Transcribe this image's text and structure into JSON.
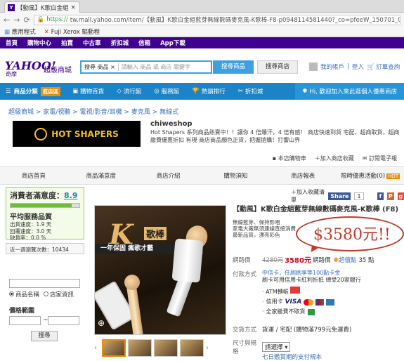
{
  "browser": {
    "tab_title": "【動風】K歌白金組",
    "url_prefix": "https://",
    "url": "tw.mall.yahoo.com/item/【動風】K歌白金組藍芽無線數碼麥克風-K歌棒-F8-p0948114581440?_co=pfeeW_150701_01",
    "bookmarks": [
      "應用程式",
      "Fuji Xerox 驅動程"
    ]
  },
  "ynav": [
    "首頁",
    "購物中心",
    "拍賣",
    "中古車",
    "折扣城",
    "信箱",
    "App下載"
  ],
  "header": {
    "logo": "YAHOO!",
    "logo_sub": "奇摩",
    "mall_name": "超級商城",
    "search_scope": "搜尋 商品 ×",
    "search_placeholder": "請輸入 商品 或 商店 關鍵字",
    "search_goods": "搜尋商品",
    "search_store": "搜尋商店",
    "account": "我的帳戶",
    "login": "登入",
    "orders": "訂單查詢"
  },
  "catbar": {
    "menu": "商品分類",
    "tag": "逛店區",
    "links": [
      "購物百貨",
      "流行館",
      "服務館",
      "熱銷排行",
      "折扣城"
    ],
    "notice": "Hi, 歡迎加入來此逛個人優惠商店"
  },
  "breadcrumb": "超級商城 > 家電/視聽 > 電視/影音/耳機 > 麥克風 > 無線式",
  "shop": {
    "banner": "HOT SHAPERS",
    "name": "chiweshop",
    "desc": "Hot Shapers 系列商品熱賣中！！讓你 4 倍爆汗，4 倍有感！ 商店快速到貨 宅配，超商取貨，超商繳費優惠折扣 有現 商店商品顏色正貨，把握搶購！打響山界",
    "tools": [
      "本店購物車",
      "加入商店收藏",
      "訂閱電子報"
    ],
    "nav": [
      "商店首頁",
      "商品滿意度",
      "商店介紹",
      "購物須知",
      "商店報表",
      "限時優惠活動(0)"
    ],
    "hot_tag": "HOT"
  },
  "rating": {
    "label": "消費者滿意度：",
    "score": "8.9",
    "score_fill": 0.89,
    "avg": "平均服務品質",
    "stats": [
      "出貨速度：1.9 天",
      "回覆速度：3.0 天",
      "缺貨率：0.0 %"
    ],
    "review": "近一週瀏覽次數：10434"
  },
  "search_panel": {
    "opt1": "商品名稱",
    "opt2": "店家資訊",
    "price_range": "價格範圍",
    "dash": "~",
    "submit": "搜尋"
  },
  "social": {
    "fav": "加入收藏清單",
    "share": "Share",
    "count": "1"
  },
  "product": {
    "image_k": "K",
    "image_badge": "歌棒",
    "image_ribbon": "一年保固 瘋歌才藝",
    "title": "【動風】K歌白金組藍芽無線數碼麥克風-K歌棒 (F8)",
    "features": [
      "無線藍芽、保持影唱",
      "家電大廠無須連線直接消費",
      "最新品質，漂亮彩色"
    ],
    "annotation": "$3580元!!",
    "price_label": "網路價",
    "old_price": "4280元",
    "new_price": "3580元",
    "price_note": "網路價",
    "points_label": "超值點",
    "points": "35 點",
    "pay_label": "付款方式",
    "pay_line1": "中信卡，任刷刷享等100點卡金",
    "pay_line2": "刷卡可用信用卡紅利折抵 總受20家銀行",
    "atm": "ATM轉帳",
    "card": "信用卡",
    "card_brand": "VISA",
    "store_pay": "全家繳費不取貨",
    "ship_label": "交貨方式",
    "ship": "貨運 / 宅配 (購物滿799元免運費)",
    "spec_label": "尺寸與規格",
    "spec_select": "請選擇",
    "bottom": "七日鑑賞期的支付規本"
  }
}
